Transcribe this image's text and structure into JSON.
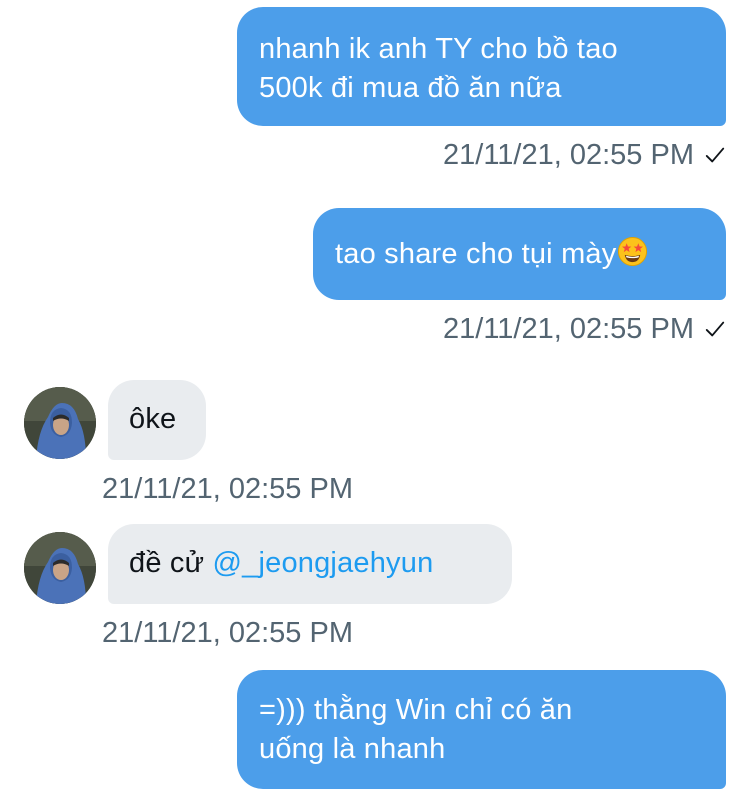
{
  "messages": [
    {
      "direction": "outgoing",
      "lines": [
        "nhanh ik anh TY cho bồ tao",
        "500k đi mua đồ ăn nữa"
      ],
      "timestamp": "21/11/21, 02:55 PM",
      "status_icon": "checkmark-icon"
    },
    {
      "direction": "outgoing",
      "text": "tao share cho tụi mày",
      "emoji": "star-struck-emoji",
      "timestamp": "21/11/21, 02:55 PM",
      "status_icon": "checkmark-icon"
    },
    {
      "direction": "incoming",
      "text": "ôke",
      "timestamp": "21/11/21, 02:55 PM"
    },
    {
      "direction": "incoming",
      "text": "đề cử ",
      "mention": "@_jeongjaehyun",
      "timestamp": "21/11/21, 02:55 PM"
    },
    {
      "direction": "outgoing",
      "lines": [
        "=))) thằng Win chỉ có ăn",
        "uống là nhanh"
      ]
    }
  ],
  "colors": {
    "outgoing_bubble": "#4c9eea",
    "incoming_bubble": "#e9ecef",
    "mention": "#1d9bf0",
    "timestamp": "#536471"
  }
}
